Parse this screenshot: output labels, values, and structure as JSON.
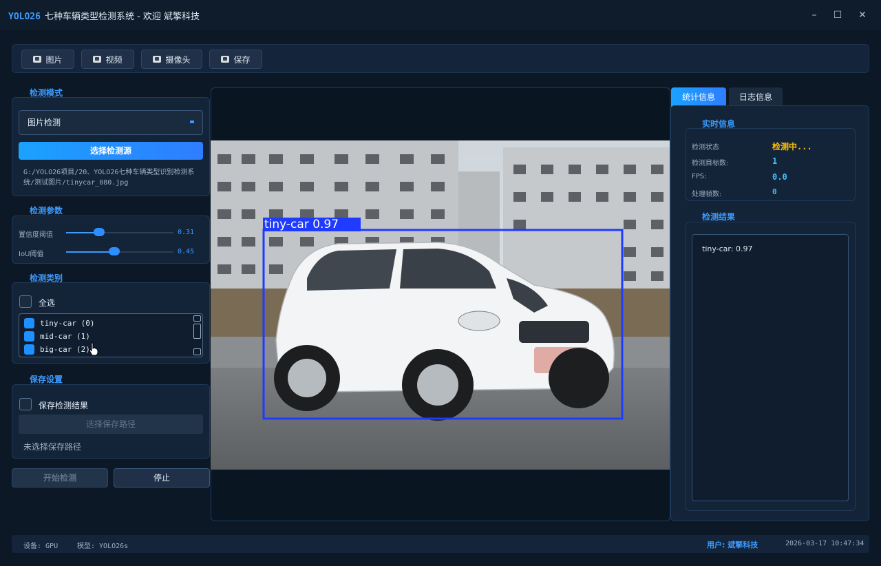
{
  "window": {
    "brand": "YOLO26",
    "title": "七种车辆类型检测系统 - 欢迎 斌擎科技",
    "minimize": "–",
    "maximize": "☐",
    "close": "✕"
  },
  "toolbar": {
    "image_label": "图片",
    "video_label": "视频",
    "camera_label": "摄像头",
    "save_label": "保存"
  },
  "detect_mode": {
    "title": "检测模式",
    "selected": "图片检测",
    "choose_source_label": "选择检测源",
    "source_path": "G:/YOLO26项目/20、YOLO26七种车辆类型识别检测系统/测试图片/tinycar_080.jpg"
  },
  "params": {
    "title": "检测参数",
    "confidence": {
      "label": "置信度阈值",
      "value": "0.31",
      "fraction": 0.31
    },
    "iou": {
      "label": "IoU阈值",
      "value": "0.45",
      "fraction": 0.45
    }
  },
  "classes": {
    "title": "检测类别",
    "select_all": "全选",
    "items": [
      {
        "label": "tiny-car (0)",
        "checked": true
      },
      {
        "label": "mid-car (1)",
        "checked": true
      },
      {
        "label": "big-car (2)",
        "checked": true
      }
    ]
  },
  "save": {
    "title": "保存设置",
    "save_results": "保存检测结果",
    "choose_path": "选择保存路径",
    "path_status": "未选择保存路径"
  },
  "actions": {
    "start": "开始检测",
    "stop": "停止"
  },
  "viewer": {
    "detection_label": "tiny-car 0.97"
  },
  "tabs": {
    "stats": "统计信息",
    "log": "日志信息"
  },
  "realtime": {
    "title": "实时信息",
    "status_label": "检测状态",
    "status_value": "检测中...",
    "count_label": "检测目标数:",
    "count_value": "1",
    "fps_label": "FPS:",
    "fps_value": "0.0",
    "frames_label": "处理帧数:",
    "frames_value": "0"
  },
  "results": {
    "title": "检测结果",
    "lines": [
      "tiny-car: 0.97"
    ]
  },
  "status": {
    "device": "设备: GPU",
    "model": "模型: YOLO26s",
    "user": "用户: 斌擎科技",
    "datetime": "2026-03-17 10:47:34"
  },
  "colors": {
    "accent": "#3d9bff",
    "warning": "#ffc107",
    "bbox": "#1f3bff"
  }
}
